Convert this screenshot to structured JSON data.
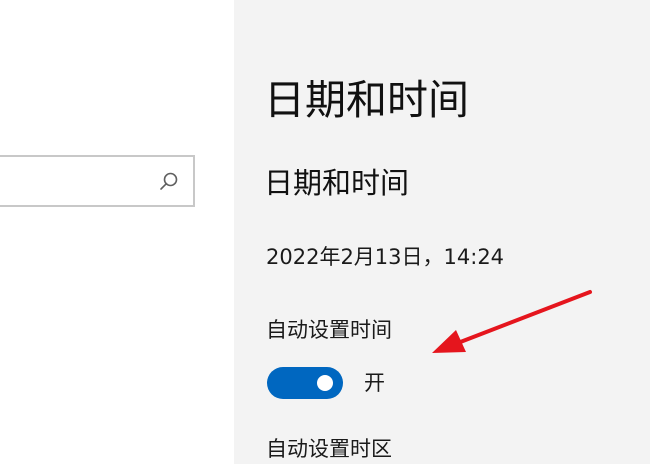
{
  "window": {
    "page_title": "日期和时间"
  },
  "navigation": {
    "search": {
      "value": "",
      "placeholder": "",
      "icon": "search-icon"
    }
  },
  "main": {
    "section_title": "日期和时间",
    "current_datetime": "2022年2月13日，14:24",
    "settings": [
      {
        "label": "自动设置时间",
        "toggle_state": "开",
        "enabled": true
      },
      {
        "label": "自动设置时区"
      }
    ]
  },
  "colors": {
    "accent": "#0067c0",
    "content_background": "#f3f3f3",
    "annotation_arrow": "#e5151d"
  }
}
